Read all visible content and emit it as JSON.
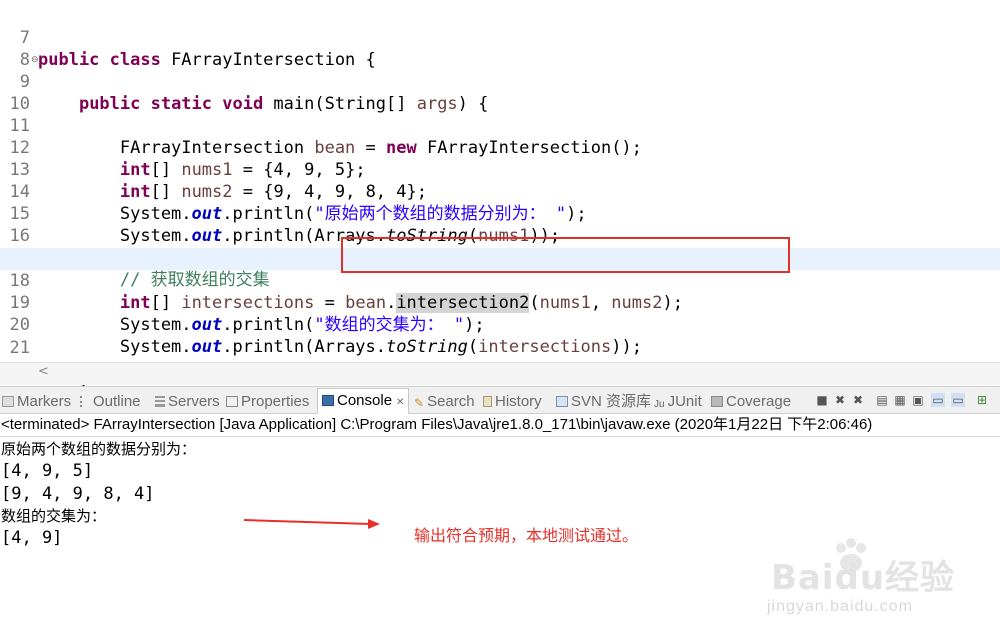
{
  "editor": {
    "lines": [
      {
        "num": "7",
        "code": "public class FArrayIntersection {"
      },
      {
        "num": "8",
        "code": ""
      },
      {
        "num": "9",
        "code": "    public static void main(String[] args) {"
      },
      {
        "num": "10",
        "code": ""
      },
      {
        "num": "11",
        "code": "        FArrayIntersection bean = new FArrayIntersection();"
      },
      {
        "num": "12",
        "code": "        int[] nums1 = {4, 9, 5};"
      },
      {
        "num": "13",
        "code": "        int[] nums2 = {9, 4, 9, 8, 4};"
      },
      {
        "num": "14",
        "code": "        System.out.println(\"原始两个数组的数据分别为： \");"
      },
      {
        "num": "15",
        "code": "        System.out.println(Arrays.toString(nums1));"
      },
      {
        "num": "16",
        "code": "        System.out.println(Arrays.toString(nums2));"
      },
      {
        "num": "17",
        "code": "        // 获取数组的交集"
      },
      {
        "num": "18",
        "code": "        int[] intersections = bean.intersection2(nums1, nums2);"
      },
      {
        "num": "19",
        "code": "        System.out.println(\"数组的交集为： \");"
      },
      {
        "num": "20",
        "code": "        System.out.println(Arrays.toString(intersections));"
      },
      {
        "num": "21",
        "code": ""
      },
      {
        "num": "22",
        "code": "    }"
      }
    ],
    "current_line": "18"
  },
  "tabs": [
    {
      "label": "Markers",
      "icon": "markers-icon"
    },
    {
      "label": "Outline",
      "icon": "outline-icon"
    },
    {
      "label": "Servers",
      "icon": "servers-icon"
    },
    {
      "label": "Properties",
      "icon": "properties-icon"
    },
    {
      "label": "Console",
      "icon": "console-icon",
      "active": true
    },
    {
      "label": "Search",
      "icon": "search-icon"
    },
    {
      "label": "History",
      "icon": "history-icon"
    },
    {
      "label": "SVN 资源库",
      "icon": "svn-icon"
    },
    {
      "label": "JUnit",
      "icon": "junit-icon"
    },
    {
      "label": "Coverage",
      "icon": "coverage-icon"
    }
  ],
  "console": {
    "header": "<terminated> FArrayIntersection [Java Application] C:\\Program Files\\Java\\jre1.8.0_171\\bin\\javaw.exe (2020年1月22日 下午2:06:46)",
    "output": [
      "原始两个数组的数据分别为：",
      "[4, 9, 5]",
      "[9, 4, 9, 8, 4]",
      "数组的交集为：",
      "[4, 9]"
    ]
  },
  "annotation": {
    "text": "输出符合预期，本地测试通过。",
    "color": "#e8302a"
  },
  "watermark": {
    "logo": "Baidu经验",
    "url": "jingyan.baidu.com"
  },
  "colors": {
    "keyword": "#7f0055",
    "string": "#2a00ff",
    "comment": "#3f7f5f",
    "static_field": "#0000c0",
    "current_line_bg": "#e8f2fe",
    "highlight_box": "#e0302a"
  }
}
